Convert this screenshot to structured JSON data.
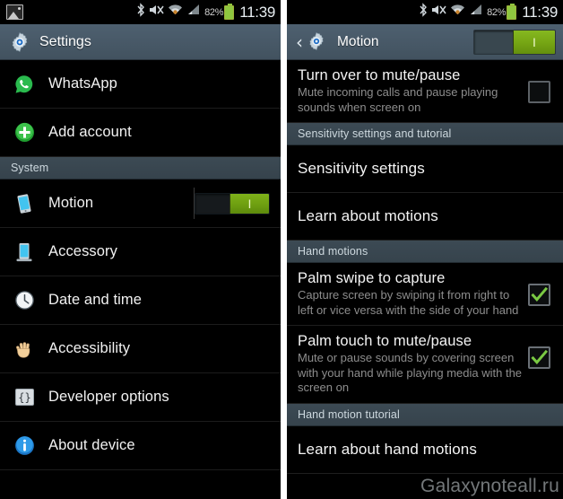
{
  "status_bar": {
    "photo_icon": "photo-icon",
    "bluetooth_icon": "bluetooth-icon",
    "mute_icon": "speaker-mute-icon",
    "wifi_icon": "wifi-icon",
    "signal_icon": "cellular-signal-icon",
    "battery_percent": "82%",
    "time": "11:39"
  },
  "left_panel": {
    "header": {
      "icon": "gear-icon",
      "title": "Settings"
    },
    "items": [
      {
        "label": "WhatsApp",
        "icon": "whatsapp-icon",
        "type": "item"
      },
      {
        "label": "Add account",
        "icon": "add-plus-icon",
        "type": "item"
      },
      {
        "label": "System",
        "icon": "",
        "type": "section"
      },
      {
        "label": "Motion",
        "icon": "phone-tilt-icon",
        "type": "toggle",
        "toggle_state": "on",
        "toggle_glyph": "I"
      },
      {
        "label": "Accessory",
        "icon": "phone-dock-icon",
        "type": "item"
      },
      {
        "label": "Date and time",
        "icon": "clock-icon",
        "type": "item"
      },
      {
        "label": "Accessibility",
        "icon": "hand-icon",
        "type": "item"
      },
      {
        "label": "Developer options",
        "icon": "braces-icon",
        "type": "item"
      },
      {
        "label": "About device",
        "icon": "info-icon",
        "type": "item"
      }
    ]
  },
  "right_panel": {
    "header": {
      "back_icon": "back-chevron-icon",
      "icon": "gear-icon",
      "title": "Motion",
      "toggle_state": "on",
      "toggle_glyph": "I"
    },
    "items": [
      {
        "type": "checkbox",
        "title": "Turn over to mute/pause",
        "subtitle": "Mute incoming calls and pause playing sounds when screen on",
        "checked": false
      },
      {
        "type": "section",
        "title": "Sensitivity settings and tutorial"
      },
      {
        "type": "simple",
        "title": "Sensitivity settings"
      },
      {
        "type": "simple",
        "title": "Learn about motions"
      },
      {
        "type": "section",
        "title": "Hand motions"
      },
      {
        "type": "checkbox",
        "title": "Palm swipe to capture",
        "subtitle": "Capture screen by swiping it from right to left or vice versa with the side of your hand",
        "checked": true
      },
      {
        "type": "checkbox",
        "title": "Palm touch to mute/pause",
        "subtitle": "Mute or pause sounds by covering screen with your hand while playing media with the screen on",
        "checked": true
      },
      {
        "type": "section",
        "title": "Hand motion tutorial"
      },
      {
        "type": "simple",
        "title": "Learn about hand motions"
      }
    ]
  },
  "watermark": {
    "text": "Galaxynoteall.ru"
  },
  "colors": {
    "accent_green": "#76a614",
    "header_blue_gray": "#4a5a68",
    "section_header": "#39464f",
    "background": "#000000",
    "primary_text": "#f2f2f2",
    "secondary_text": "#8d8d8d"
  }
}
